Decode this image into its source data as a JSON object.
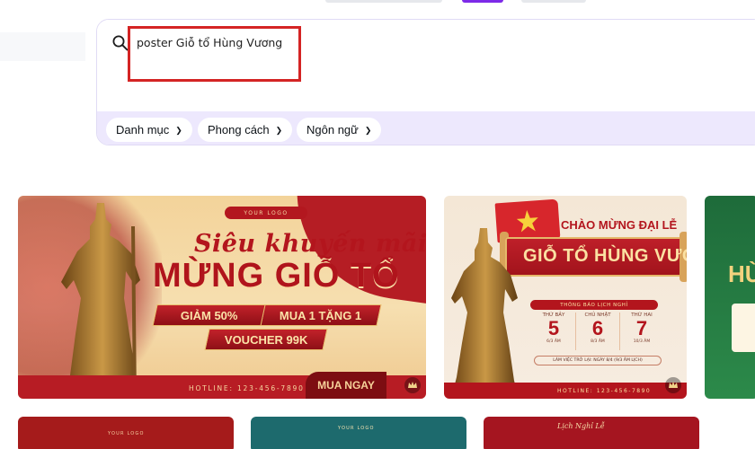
{
  "search": {
    "query": "poster Giỗ tổ Hùng Vương"
  },
  "filters": [
    {
      "label": "Danh mục"
    },
    {
      "label": "Phong cách"
    },
    {
      "label": "Ngôn ngữ"
    }
  ],
  "colors": {
    "accent": "#7d2ae8",
    "filter_bar": "#ede8fd",
    "highlight": "#d42424",
    "poster_red": "#b3151d",
    "poster_gold": "#f3d39a"
  },
  "cards": [
    {
      "logo": "YOUR LOGO",
      "script_title": "Siêu khuyến mãi",
      "title": "MỪNG GIỖ TỔ",
      "promos": [
        "GIẢM 50%",
        "MUA 1 TẶNG 1",
        "VOUCHER 99K"
      ],
      "hotline": "HOTLINE: 123-456-7890",
      "cta": "MUA NGAY"
    },
    {
      "title_top": "CHÀO MỪNG ĐẠI LỄ",
      "title_main": "GIỖ TỔ HÙNG VƯƠNG",
      "notice": "THÔNG BÁO LỊCH NGHỈ",
      "days": [
        {
          "name": "THỨ BẢY",
          "num": "5",
          "lunar": "6/3 ÂM"
        },
        {
          "name": "CHỦ NHẬT",
          "num": "6",
          "lunar": "8/3 ÂM"
        },
        {
          "name": "THỨ HAI",
          "num": "7",
          "lunar": "10/3 ÂM"
        }
      ],
      "resume": "LÀM VIỆC TRỞ LẠI: NGÀY 8/4 (9/3 ÂM LỊCH)",
      "hotline": "HOTLINE: 123-456-7890"
    },
    {
      "title": "HÙ"
    },
    {
      "logo": "YOUR LOGO"
    },
    {
      "logo": "YOUR LOGO"
    },
    {
      "script_title": "Lịch Nghỉ Lễ"
    }
  ]
}
